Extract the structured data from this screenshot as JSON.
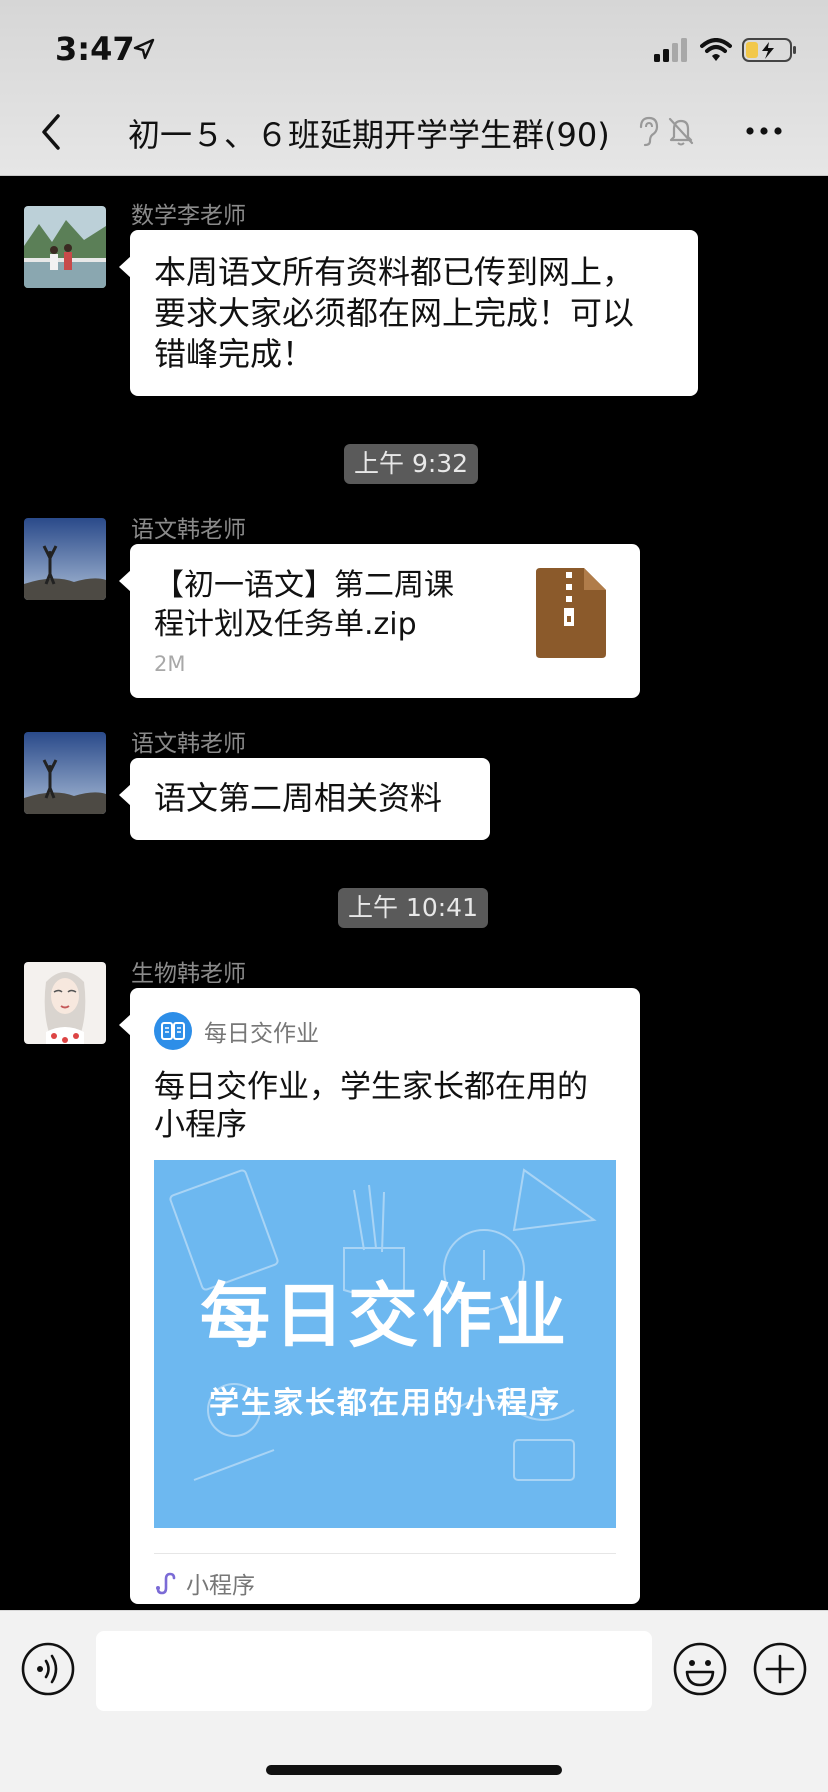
{
  "status_bar": {
    "time": "3:47"
  },
  "header": {
    "title": "初一５、６班延期开学学生群(90)"
  },
  "messages": [
    {
      "sender": "数学李老师",
      "lines": [
        "本周语文所有资料都已传到网上，",
        "要求大家必须都在网上完成！可以",
        "错峰完成！"
      ]
    },
    {
      "sender": "语文韩老师",
      "file_lines": [
        "【初一语文】第二周课",
        "程计划及任务单.zip"
      ],
      "file_size": "2M"
    },
    {
      "sender": "语文韩老师",
      "text": "语文第二周相关资料"
    },
    {
      "sender": "生物韩老师",
      "mini_program": {
        "app_name": "每日交作业",
        "title_lines": [
          "每日交作业，学生家长都在用的",
          "小程序"
        ],
        "banner_title": "每日交作业",
        "banner_subtitle": "学生家长都在用的小程序",
        "footer_label": "小程序"
      }
    }
  ],
  "timestamps": [
    "上午 9:32",
    "上午 10:41"
  ],
  "colors": {
    "chat_background": "#000000",
    "bubble": "#ffffff",
    "banner": "#6db8f0",
    "zip_icon": "#8b5a2b"
  }
}
